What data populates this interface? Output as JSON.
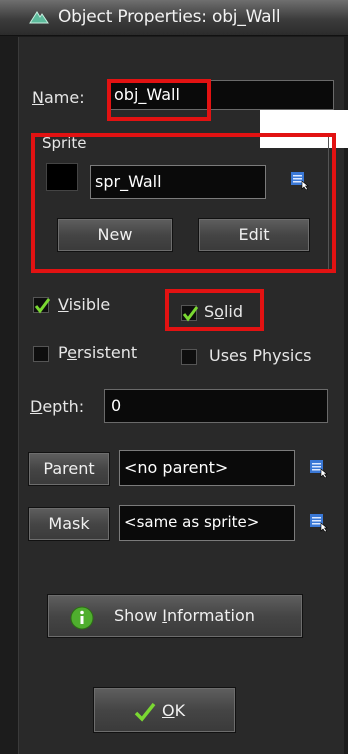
{
  "window": {
    "title": "Object Properties: obj_Wall"
  },
  "name": {
    "label": "Name:",
    "value": "obj_Wall"
  },
  "sprite": {
    "group_label": "Sprite",
    "value": "spr_Wall",
    "new_label": "New",
    "edit_label": "Edit"
  },
  "options": {
    "visible_label": "Visible",
    "visible_checked": true,
    "solid_label": "Solid",
    "solid_checked": true,
    "persistent_label": "Persistent",
    "persistent_checked": false,
    "physics_label": "Uses Physics",
    "physics_checked": false
  },
  "depth": {
    "label": "Depth:",
    "value": "0"
  },
  "parent": {
    "button_label": "Parent",
    "value": "<no parent>"
  },
  "mask": {
    "button_label": "Mask",
    "value": "<same as sprite>"
  },
  "show_info_label": "Show Information",
  "ok_label": "OK",
  "colors": {
    "highlight": "#e21212",
    "checkmark": "#7ad832",
    "browse_icon": "#3a78d6"
  },
  "icons": [
    "app-icon",
    "browse-icon",
    "checkmark-icon",
    "info-icon"
  ]
}
